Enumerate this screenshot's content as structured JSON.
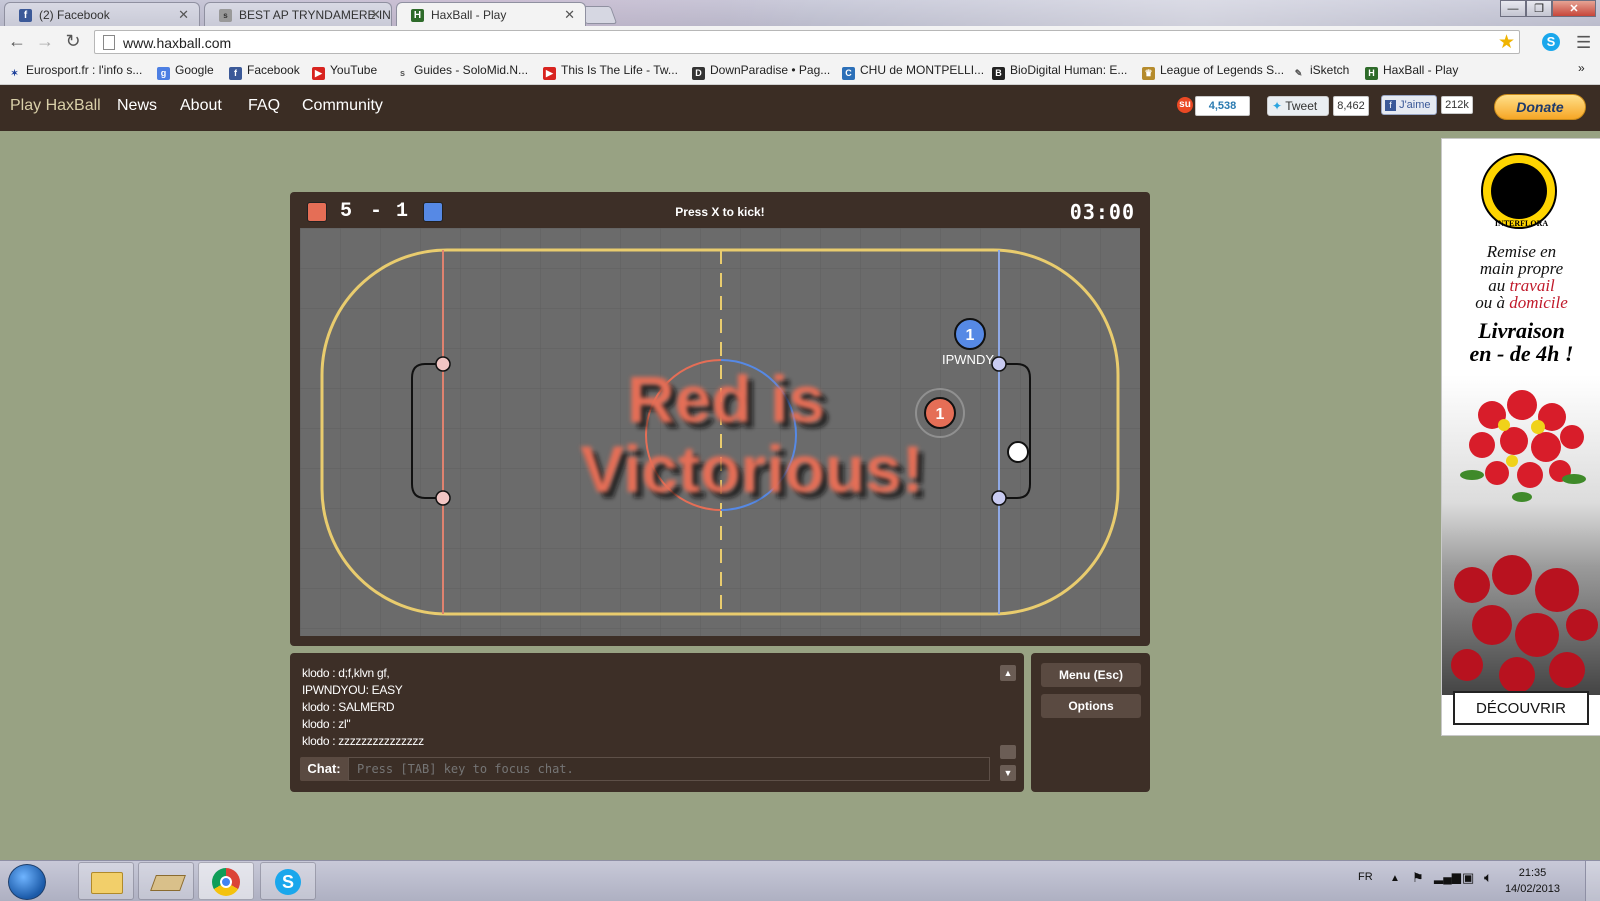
{
  "browser": {
    "tabs": [
      {
        "label": "(2) Facebook",
        "icon": "facebook-icon",
        "active": false
      },
      {
        "label": "BEST AP TRYNDAMERE IN",
        "icon": "solomid-icon",
        "active": false
      },
      {
        "label": "HaxBall - Play",
        "icon": "haxball-icon",
        "active": true
      }
    ],
    "url": "www.haxball.com",
    "bookmarks": [
      "Eurosport.fr : l'info s...",
      "Google",
      "Facebook",
      "YouTube",
      "Guides - SoloMid.N...",
      "This Is The Life - Tw...",
      "DownParadise • Pag...",
      "CHU de MONTPELLI...",
      "BioDigital Human: E...",
      "League of Legends S...",
      "iSketch",
      "HaxBall - Play"
    ]
  },
  "site": {
    "brand": "Play HaxBall",
    "nav": [
      "News",
      "About",
      "FAQ",
      "Community"
    ],
    "social": {
      "stumble_count": "4,538",
      "tweet_label": "Tweet",
      "tweet_count": "8,462",
      "like_label": "J'aime",
      "like_count": "212k"
    },
    "donate": "Donate"
  },
  "game": {
    "red_score": "5",
    "separator": "-",
    "blue_score": "1",
    "hint": "Press X to kick!",
    "timer": "03:00",
    "victory_line1": "Red is",
    "victory_line2": "Victorious!",
    "blue_player_number": "1",
    "blue_player_name": "IPWNDY",
    "red_player_number": "1",
    "colors": {
      "red": "#e56e56",
      "blue": "#5689e5",
      "field": "#6b6b6b",
      "border": "#e9cc6e",
      "panel": "#3d2f27"
    }
  },
  "chat": {
    "messages": [
      "klodo : d;f,klvn gf,",
      "IPWNDYOU: EASY",
      "klodo : SALMERD",
      "klodo : zl\"",
      "klodo : zzzzzzzzzzzzzzz"
    ],
    "label": "Chat:",
    "placeholder": "Press [TAB] key to focus chat."
  },
  "side": {
    "menu": "Menu (Esc)",
    "options": "Options"
  },
  "ad": {
    "brand": "INTERFLORA",
    "line1": "Remise en",
    "line2": "main propre",
    "line3_pre": "au ",
    "line3_red": "travail",
    "line4_pre": "ou à ",
    "line4_red": "domicile",
    "headline1": "Livraison",
    "headline2": "en - de 4h !",
    "cta": "DÉCOUVRIR"
  },
  "taskbar": {
    "lang": "FR",
    "time": "21:35",
    "date": "14/02/2013"
  }
}
